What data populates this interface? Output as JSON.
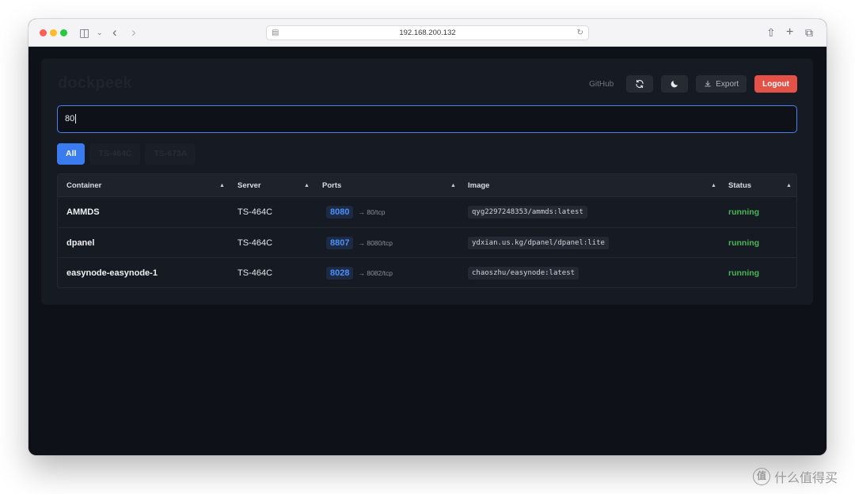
{
  "browser": {
    "url": "192.168.200.132",
    "icons": [
      "sidebar-icon",
      "chevron-down-icon",
      "back-icon",
      "forward-icon",
      "page-icon",
      "translate-icon",
      "reload-icon",
      "share-icon",
      "new-tab-icon",
      "tabs-overview-icon"
    ]
  },
  "app": {
    "logo": "dockpeek",
    "github_label": "GitHub",
    "export_label": "Export",
    "logout_label": "Logout",
    "colors": {
      "accent": "#3b7bf0",
      "logout": "#e45247",
      "running": "#49b657"
    }
  },
  "search": {
    "value": "80"
  },
  "tabs": [
    {
      "label": "All",
      "active": true
    },
    {
      "label": "TS-464C",
      "active": false
    },
    {
      "label": "TS-673A",
      "active": false
    }
  ],
  "table": {
    "headers": {
      "container": "Container",
      "server": "Server",
      "ports": "Ports",
      "image": "Image",
      "status": "Status"
    },
    "rows": [
      {
        "container": "AMMDS",
        "server": "TS-464C",
        "port": "8080",
        "port_map": "→ 80/tcp",
        "image": "qyg2297248353/ammds:latest",
        "status": "running"
      },
      {
        "container": "dpanel",
        "server": "TS-464C",
        "port": "8807",
        "port_map": "→ 8080/tcp",
        "image": "ydxian.us.kg/dpanel/dpanel:lite",
        "status": "running"
      },
      {
        "container": "easynode-easynode-1",
        "server": "TS-464C",
        "port": "8028",
        "port_map": "→ 8082/tcp",
        "image": "chaoszhu/easynode:latest",
        "status": "running"
      }
    ]
  },
  "watermark": {
    "logo_char": "值",
    "text": "什么值得买"
  }
}
